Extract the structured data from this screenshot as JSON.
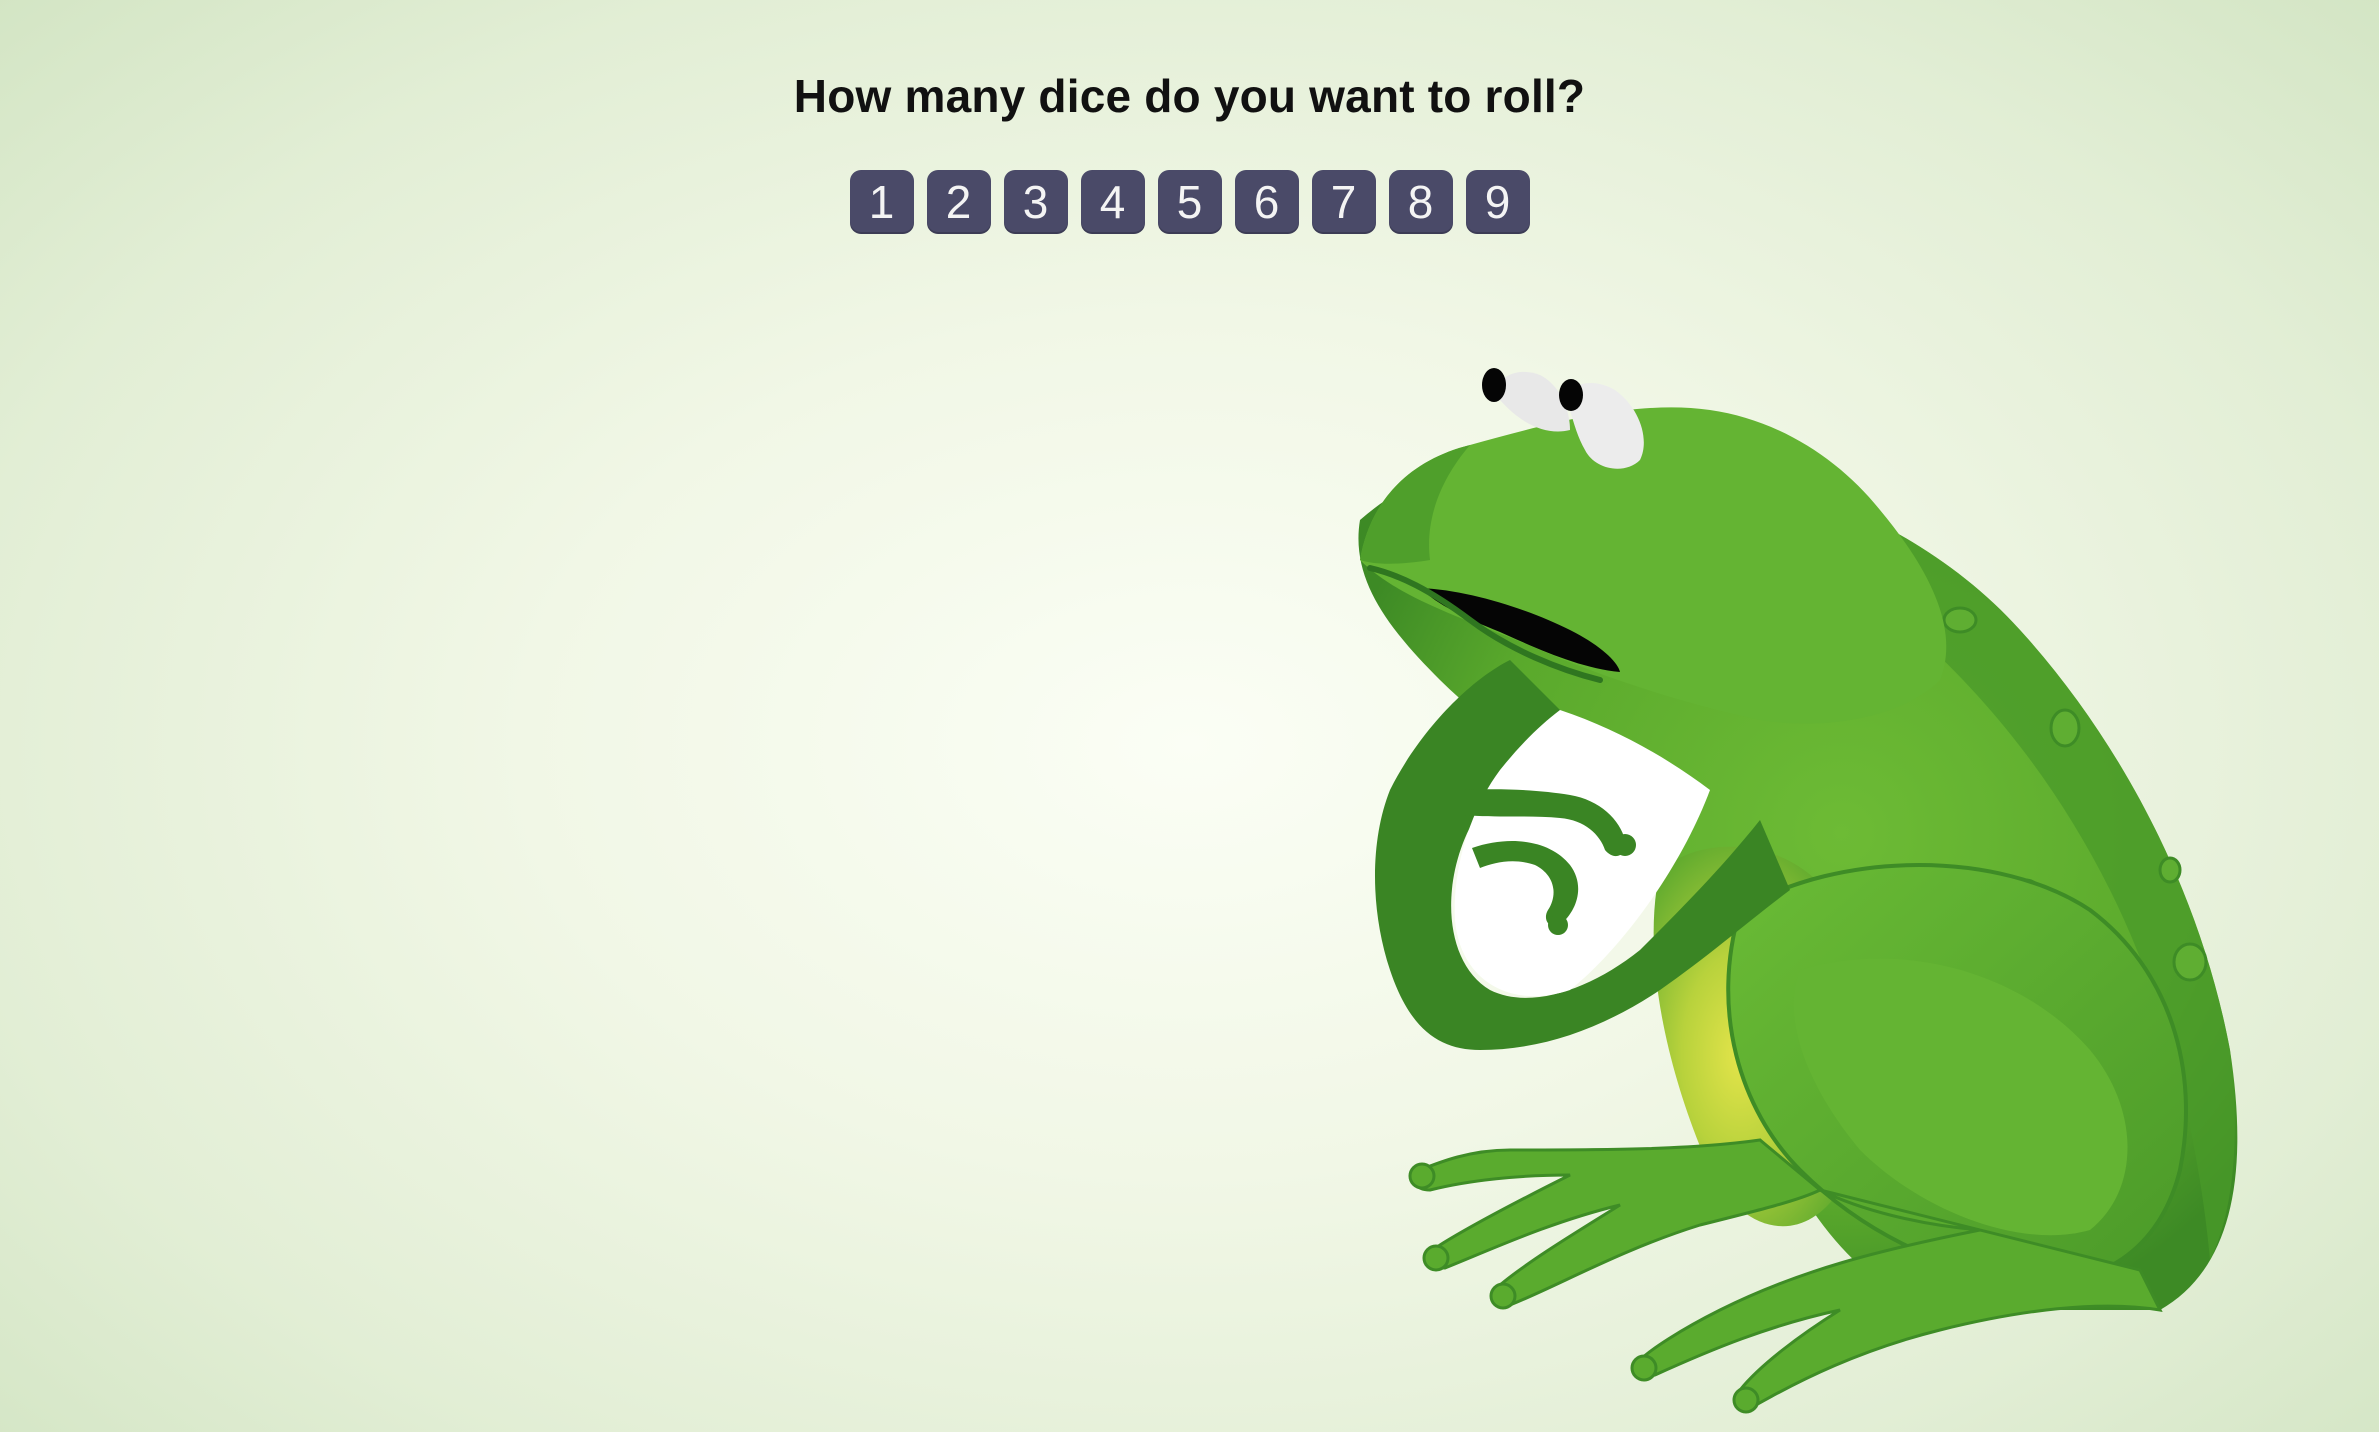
{
  "prompt": {
    "question": "How many dice do you want to roll?"
  },
  "dice_options": [
    "1",
    "2",
    "3",
    "4",
    "5",
    "6",
    "7",
    "8",
    "9"
  ],
  "colors": {
    "button_bg": "#4a4a68",
    "button_text": "#f4f4f4",
    "frog_green": "#62b22f",
    "frog_dark": "#3a8524",
    "frog_belly": "#d8e04a"
  },
  "illustration": {
    "icon": "frog-illustration"
  }
}
